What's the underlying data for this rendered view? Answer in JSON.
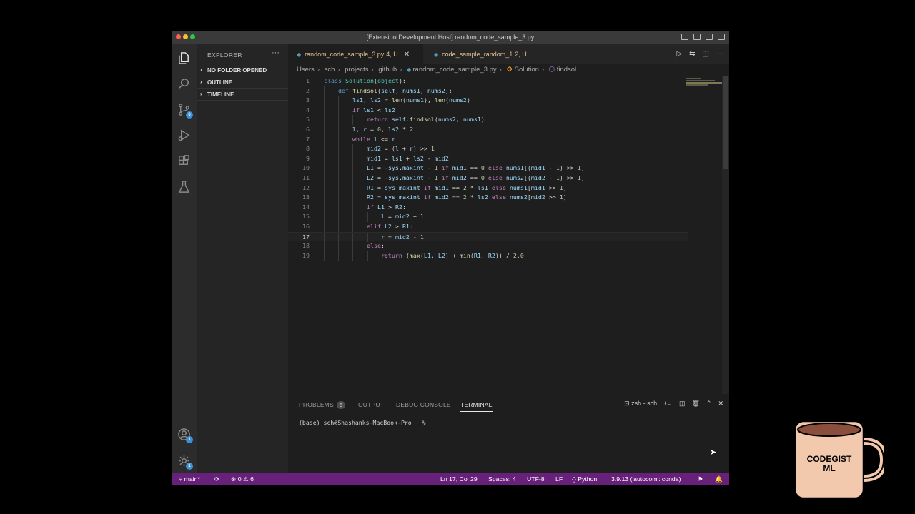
{
  "window": {
    "title": "[Extension Development Host] random_code_sample_3.py",
    "traffic_colors": [
      "#ff5f57",
      "#febc2e",
      "#28c840"
    ]
  },
  "activity_bar": {
    "items": [
      {
        "icon": "files-icon"
      },
      {
        "icon": "search-icon"
      },
      {
        "icon": "source-control-icon",
        "badge": "6"
      },
      {
        "icon": "run-debug-icon"
      },
      {
        "icon": "extensions-icon"
      },
      {
        "icon": "testing-icon"
      }
    ],
    "account_badge": "1",
    "settings_badge": "1"
  },
  "sidebar": {
    "title": "EXPLORER",
    "more": "···",
    "sections": [
      "NO FOLDER OPENED",
      "OUTLINE",
      "TIMELINE"
    ]
  },
  "tabs": [
    {
      "name": "random_code_sample_3.py",
      "status": "4, U",
      "active": true
    },
    {
      "name": "code_sample_random_1",
      "status": "2, U",
      "active": false
    }
  ],
  "breadcrumbs": {
    "parts": [
      "Users",
      "sch",
      "projects",
      "github",
      "random_code_sample_3.py",
      "Solution",
      "findsol"
    ]
  },
  "code": {
    "current_line": 17,
    "lines": [
      "class Solution(object):",
      "    def findsol(self, nums1, nums2):",
      "        ls1, ls2 = len(nums1), len(nums2)",
      "        if ls1 < ls2:",
      "            return self.findsol(nums2, nums1)",
      "        l, r = 0, ls2 * 2",
      "        while l <= r:",
      "            mid2 = (l + r) >> 1",
      "            mid1 = ls1 + ls2 - mid2",
      "            L1 = -sys.maxint - 1 if mid1 == 0 else nums1[(mid1 - 1) >> 1]",
      "            L2 = -sys.maxint - 1 if mid2 == 0 else nums2[(mid2 - 1) >> 1]",
      "            R1 = sys.maxint if mid1 == 2 * ls1 else nums1[mid1 >> 1]",
      "            R2 = sys.maxint if mid2 == 2 * ls2 else nums2[mid2 >> 1]",
      "            if L1 > R2:",
      "                l = mid2 + 1",
      "            elif L2 > R1:",
      "                r = mid2 - 1",
      "            else:",
      "                return (max(L1, L2) + min(R1, R2)) / 2.0"
    ]
  },
  "panel": {
    "tabs": [
      "PROBLEMS",
      "OUTPUT",
      "DEBUG CONSOLE",
      "TERMINAL"
    ],
    "problems_count": "6",
    "active_tab": "TERMINAL",
    "terminal_name": "zsh - sch",
    "prompt": "(base) sch@Shashanks-MacBook-Pro ~ %"
  },
  "statusbar": {
    "branch": "main*",
    "errors": "0",
    "warnings": "6",
    "position": "Ln 17, Col 29",
    "spaces": "Spaces: 4",
    "encoding": "UTF-8",
    "eol": "LF",
    "language": "Python",
    "interpreter": "3.9.13 ('autocom': conda)",
    "color": "#68217a"
  },
  "logo": {
    "line1": "CODEGIST",
    "line2": "ML"
  }
}
